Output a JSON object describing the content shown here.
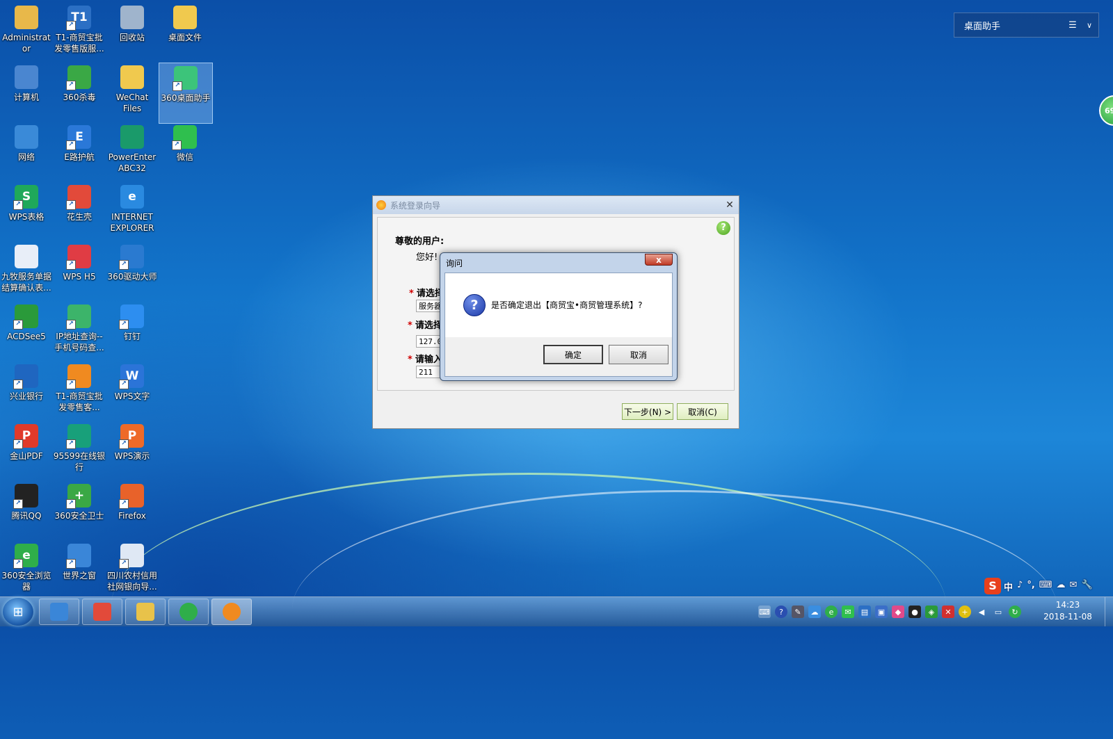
{
  "desktop": {
    "icons": [
      {
        "label": "Administrator",
        "color": "#e8b84a",
        "glyph": "",
        "shortcut": false
      },
      {
        "label": "T1-商贸宝批发零售版服...",
        "color": "#2b6fc4",
        "glyph": "T1",
        "shortcut": true
      },
      {
        "label": "回收站",
        "color": "#9fb4cc",
        "glyph": "",
        "shortcut": false
      },
      {
        "label": "桌面文件",
        "color": "#f0c94e",
        "glyph": "",
        "shortcut": false
      },
      {
        "label": "计算机",
        "color": "#4a86d0",
        "glyph": "",
        "shortcut": false
      },
      {
        "label": "360杀毒",
        "color": "#3aa845",
        "glyph": "",
        "shortcut": true
      },
      {
        "label": "WeChat Files",
        "color": "#f0c94e",
        "glyph": "",
        "shortcut": false
      },
      {
        "label": "360桌面助手",
        "color": "#3cc47a",
        "glyph": "",
        "shortcut": true
      },
      {
        "label": "网络",
        "color": "#3a8ad8",
        "glyph": "",
        "shortcut": false
      },
      {
        "label": "E路护航",
        "color": "#2a78d8",
        "glyph": "E",
        "shortcut": true
      },
      {
        "label": "PowerEnterABC32",
        "color": "#1a9a6a",
        "glyph": "",
        "shortcut": false
      },
      {
        "label": "微信",
        "color": "#2fbf4e",
        "glyph": "",
        "shortcut": true
      },
      {
        "label": "WPS表格",
        "color": "#1fa85a",
        "glyph": "S",
        "shortcut": true
      },
      {
        "label": "花生壳",
        "color": "#e24a3a",
        "glyph": "",
        "shortcut": true
      },
      {
        "label": "INTERNET EXPLORER",
        "color": "#2a8ae0",
        "glyph": "e",
        "shortcut": false
      },
      {
        "label": "九牧服务单据结算确认表...",
        "color": "#e8eef8",
        "glyph": "",
        "shortcut": false
      },
      {
        "label": "WPS H5",
        "color": "#e03c44",
        "glyph": "",
        "shortcut": true
      },
      {
        "label": "360驱动大师",
        "color": "#2a7ad0",
        "glyph": "",
        "shortcut": true
      },
      {
        "label": "ACDSee5",
        "color": "#2a9a3a",
        "glyph": "",
        "shortcut": true
      },
      {
        "label": "IP地址查询--手机号码查...",
        "color": "#3cb46a",
        "glyph": "",
        "shortcut": true
      },
      {
        "label": "钉钉",
        "color": "#2d8ef0",
        "glyph": "",
        "shortcut": true
      },
      {
        "label": "兴业银行",
        "color": "#1f66c0",
        "glyph": "",
        "shortcut": true
      },
      {
        "label": "T1-商贸宝批发零售客...",
        "color": "#f08a20",
        "glyph": "",
        "shortcut": true
      },
      {
        "label": "WPS文字",
        "color": "#2b74d8",
        "glyph": "W",
        "shortcut": true
      },
      {
        "label": "金山PDF",
        "color": "#e03a2a",
        "glyph": "P",
        "shortcut": true
      },
      {
        "label": "95599在线银行",
        "color": "#18a07a",
        "glyph": "",
        "shortcut": true
      },
      {
        "label": "WPS演示",
        "color": "#ee6a28",
        "glyph": "P",
        "shortcut": true
      },
      {
        "label": "腾讯QQ",
        "color": "#222222",
        "glyph": "",
        "shortcut": true
      },
      {
        "label": "360安全卫士",
        "color": "#3aa845",
        "glyph": "+",
        "shortcut": true
      },
      {
        "label": "Firefox",
        "color": "#e8622a",
        "glyph": "",
        "shortcut": true
      },
      {
        "label": "360安全浏览器",
        "color": "#2fae4a",
        "glyph": "e",
        "shortcut": true
      },
      {
        "label": "世界之窗",
        "color": "#3a86d8",
        "glyph": "",
        "shortcut": true
      },
      {
        "label": "四川农村信用社网银向导...",
        "color": "#dfe8f4",
        "glyph": "",
        "shortcut": true
      }
    ]
  },
  "widget": {
    "title": "桌面助手",
    "menu_icon": "☰",
    "chevron": "∨"
  },
  "float_ball": {
    "text": "69"
  },
  "login_window": {
    "title": "系统登录向导",
    "close": "✕",
    "help": "?",
    "greeting_title": "尊敬的用户:",
    "greeting_line": "您好!",
    "fields": [
      {
        "label": "请选择",
        "value": "服务器"
      },
      {
        "label": "请选择",
        "value": "127.0"
      },
      {
        "label": "请输入",
        "value": "211"
      }
    ],
    "next_button": "下一步(N) >",
    "cancel_button": "取消(C)"
  },
  "dialog": {
    "title": "询问",
    "close": "x",
    "icon": "?",
    "message": "是否确定退出【商贸宝•商贸管理系统】?",
    "ok_button": "确定",
    "cancel_button": "取消"
  },
  "taskbar": {
    "start_icon": "⊞",
    "apps": [
      "360安全浏览器",
      "花生壳",
      "资源管理器",
      "360浏览器",
      "商贸宝"
    ],
    "clock_time": "14:23",
    "clock_date": "2018-11-08"
  },
  "ime": {
    "logo": "S",
    "items": [
      "中",
      "♪",
      "°,",
      "⌨",
      "☁",
      "✉",
      "🔧"
    ]
  }
}
